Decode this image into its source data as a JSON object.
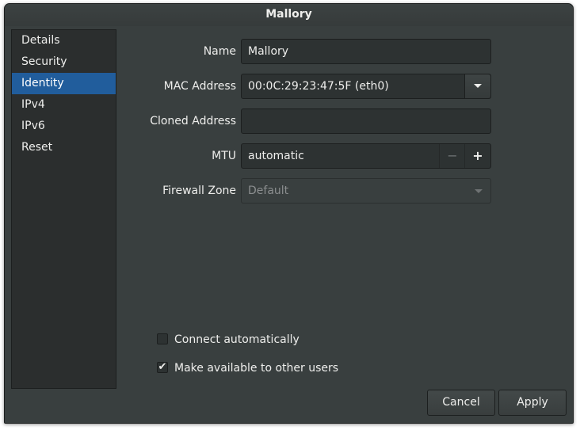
{
  "window": {
    "title": "Mallory"
  },
  "sidebar": {
    "items": [
      {
        "label": "Details"
      },
      {
        "label": "Security"
      },
      {
        "label": "Identity"
      },
      {
        "label": "IPv4"
      },
      {
        "label": "IPv6"
      },
      {
        "label": "Reset"
      }
    ],
    "selected": "Identity"
  },
  "form": {
    "name_label": "Name",
    "name_value": "Mallory",
    "mac_label": "MAC Address",
    "mac_value": "00:0C:29:23:47:5F (eth0)",
    "cloned_label": "Cloned Address",
    "cloned_value": "",
    "mtu_label": "MTU",
    "mtu_value": "automatic",
    "mtu_minus": "−",
    "mtu_plus": "+",
    "firewall_label": "Firewall Zone",
    "firewall_value": "Default"
  },
  "options": {
    "connect_auto_label": "Connect automatically",
    "connect_auto_checked": false,
    "available_label": "Make available to other users",
    "available_checked": true,
    "check_mark": "✔"
  },
  "buttons": {
    "cancel": "Cancel",
    "apply": "Apply"
  }
}
